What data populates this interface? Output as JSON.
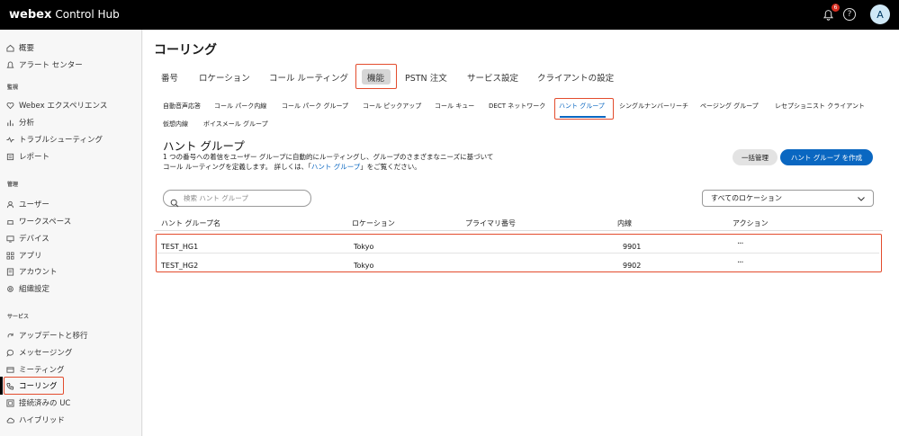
{
  "topbar": {
    "brand_webex": "webex",
    "brand_product": "Control Hub",
    "notification_count": "6",
    "help_symbol": "?",
    "avatar_initial": "A"
  },
  "sidebar": {
    "items_top": [
      {
        "label": "概要",
        "icon": "home-icon"
      },
      {
        "label": "アラート センター",
        "icon": "bell-icon"
      }
    ],
    "section_monitor": "監視",
    "items_monitor": [
      {
        "label": "Webex エクスペリエンス",
        "icon": "heart-icon"
      },
      {
        "label": "分析",
        "icon": "chart-icon"
      },
      {
        "label": "トラブルシューティング",
        "icon": "pulse-icon"
      },
      {
        "label": "レポート",
        "icon": "report-icon"
      }
    ],
    "section_manage": "管理",
    "items_manage": [
      {
        "label": "ユーザー",
        "icon": "user-icon"
      },
      {
        "label": "ワークスペース",
        "icon": "workspace-icon"
      },
      {
        "label": "デバイス",
        "icon": "device-icon"
      },
      {
        "label": "アプリ",
        "icon": "apps-icon"
      },
      {
        "label": "アカウント",
        "icon": "account-icon"
      },
      {
        "label": "組織設定",
        "icon": "gear-icon"
      }
    ],
    "section_services": "サービス",
    "items_services": [
      {
        "label": "アップデートと移行",
        "icon": "refresh-icon"
      },
      {
        "label": "メッセージング",
        "icon": "message-icon"
      },
      {
        "label": "ミーティング",
        "icon": "meeting-icon"
      },
      {
        "label": "コーリング",
        "icon": "phone-icon"
      },
      {
        "label": "接続済みの UC",
        "icon": "uc-icon"
      },
      {
        "label": "ハイブリッド",
        "icon": "cloud-icon"
      }
    ]
  },
  "main": {
    "title": "コーリング",
    "tabs": [
      "番号",
      "ロケーション",
      "コール ルーティング",
      "機能",
      "PSTN 注文",
      "サービス設定",
      "クライアントの設定"
    ],
    "subtabs_row1": [
      "自動音声応答",
      "コール パーク内線",
      "コール パーク グループ",
      "コール ピックアップ",
      "コール キュー",
      "DECT ネットワーク",
      "ハント グループ",
      "シングルナンバーリーチ",
      "ページング グループ",
      "レセプショニスト クライアント"
    ],
    "subtabs_row2": [
      "仮想内線",
      "ボイスメール グループ"
    ],
    "section_title": "ハント グループ",
    "desc_line1": "1 つの番号への着信をユーザー グループに自動的にルーティングし、グループのさまざまなニーズに基づいて",
    "desc_line2_prefix": "コール ルーティングを定義します。 詳しくは、「",
    "desc_link": "ハント グループ",
    "desc_line2_suffix": "」をご覧ください。",
    "bulk_button": "一括管理",
    "create_button": "ハント グループ を作成",
    "search_placeholder": "検索 ハント グループ",
    "location_select": "すべてのロケーション",
    "table": {
      "headers": [
        "ハント グループ名",
        "ロケーション",
        "プライマリ番号",
        "内線",
        "アクション"
      ],
      "rows": [
        {
          "name": "TEST_HG1",
          "location": "Tokyo",
          "primary": "",
          "extension": "9901",
          "action": "···"
        },
        {
          "name": "TEST_HG2",
          "location": "Tokyo",
          "primary": "",
          "extension": "9902",
          "action": "···"
        }
      ]
    }
  },
  "colors": {
    "accent_blue": "#0a67c1",
    "highlight_red": "#e34c2d",
    "topbar_bg": "#000000"
  }
}
